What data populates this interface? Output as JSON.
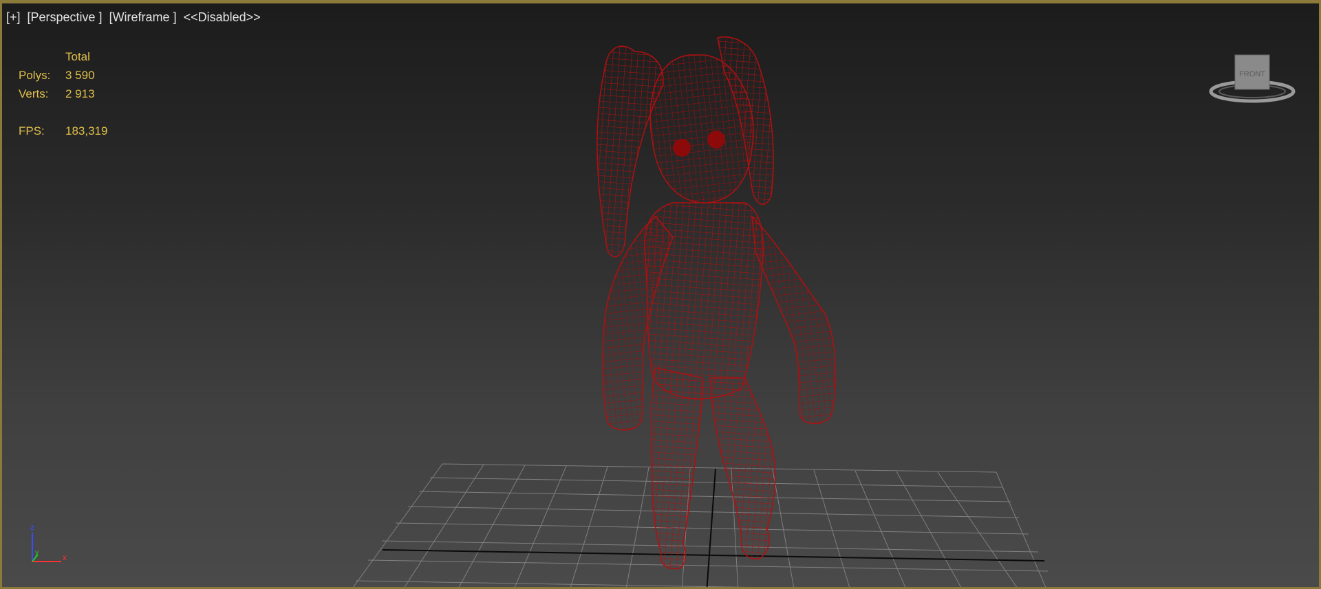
{
  "viewport": {
    "labels": [
      "[+]",
      "[Perspective ]",
      "[Wireframe ]",
      "<<Disabled>>"
    ],
    "frame_color": "#8c7a3a",
    "wire_color": "#b01010"
  },
  "stats": {
    "header": "Total",
    "polys_label": "Polys:",
    "polys_value": "3 590",
    "verts_label": "Verts:",
    "verts_value": "2 913",
    "fps_label": "FPS:",
    "fps_value": "183,319",
    "color": "#e0c04a"
  },
  "viewcube": {
    "face_label": "FRONT",
    "icon": "viewcube-icon"
  },
  "axis_tripod": {
    "z": "z",
    "y": "y",
    "x": "x",
    "icon": "axis-tripod-icon"
  },
  "grid": {
    "visible": true
  }
}
